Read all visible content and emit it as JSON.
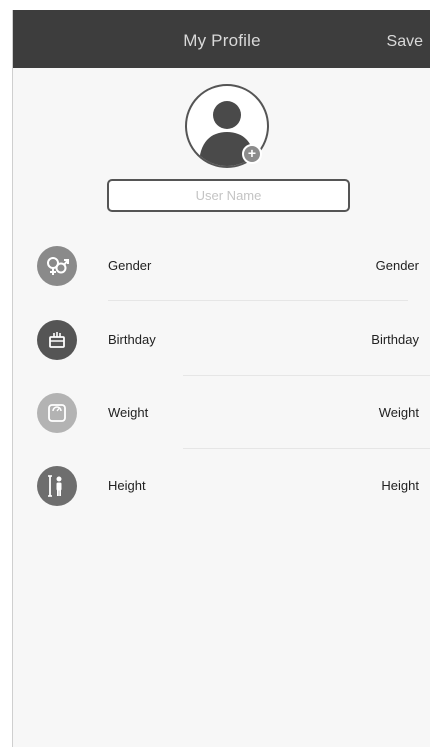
{
  "header": {
    "title": "My Profile",
    "save_label": "Save"
  },
  "profile": {
    "username_placeholder": "User Name",
    "username_value": ""
  },
  "colors": {
    "navbar": "#3d3d3d",
    "nav_text": "#d9d9d9",
    "gender_icon_bg": "#8a8a8a",
    "birthday_icon_bg": "#555555",
    "weight_icon_bg": "#b3b3b3",
    "height_icon_bg": "#6e6e6e"
  },
  "rows": [
    {
      "label": "Gender",
      "value": "Gender",
      "icon": "gender-icon"
    },
    {
      "label": "Birthday",
      "value": "Birthday",
      "icon": "cake-icon"
    },
    {
      "label": "Weight",
      "value": "Weight",
      "icon": "scale-icon"
    },
    {
      "label": "Height",
      "value": "Height",
      "icon": "height-icon"
    }
  ]
}
